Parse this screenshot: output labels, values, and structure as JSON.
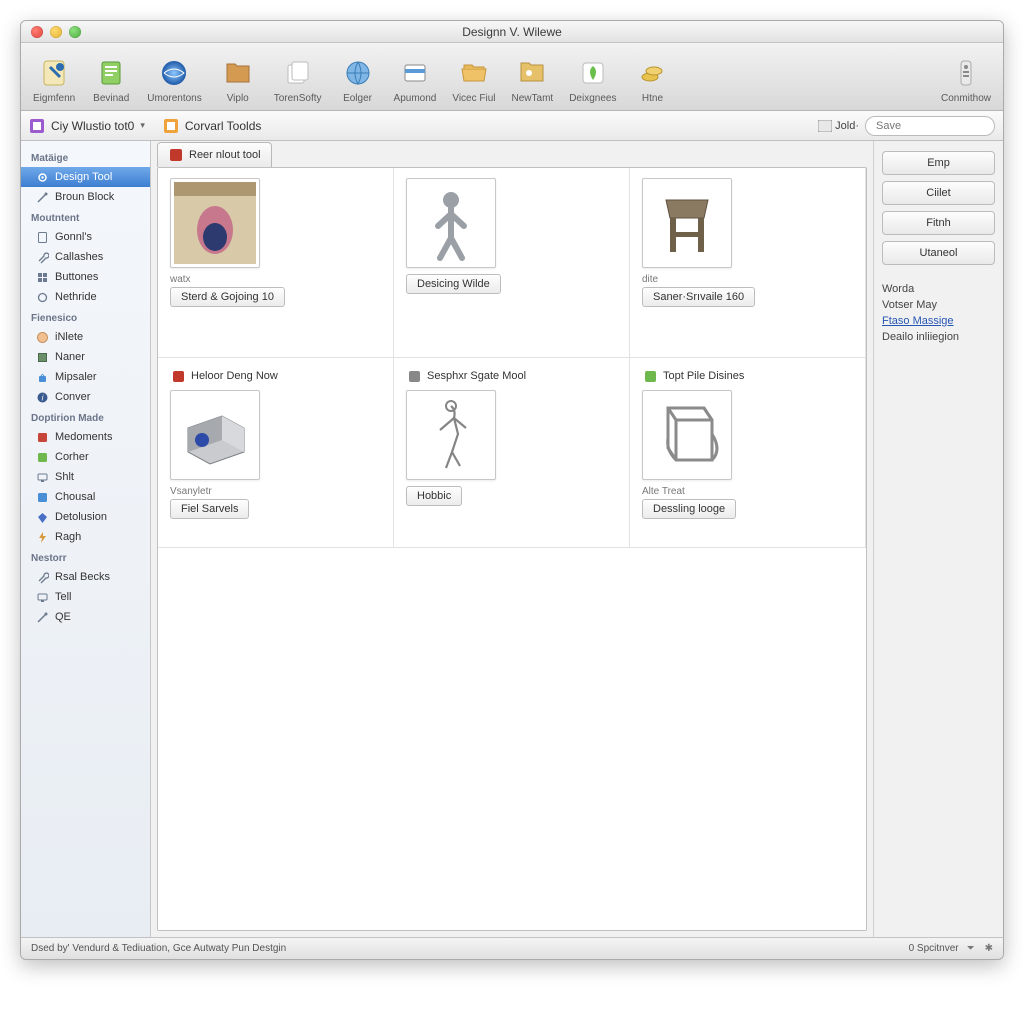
{
  "window_title": "Designn V. Wilewe",
  "toolbar": [
    {
      "id": "eigmfenn",
      "label": "Eigmfenn",
      "icon": "pin"
    },
    {
      "id": "bevinad",
      "label": "Bevinad",
      "icon": "doc-green"
    },
    {
      "id": "umorentons",
      "label": "Umorentons",
      "icon": "globe-blue"
    },
    {
      "id": "viplo",
      "label": "Viplo",
      "icon": "folder-brown"
    },
    {
      "id": "torensofty",
      "label": "TorenSofty",
      "icon": "pages"
    },
    {
      "id": "eolger",
      "label": "Eolger",
      "icon": "globe-plain"
    },
    {
      "id": "apumond",
      "label": "Apumond",
      "icon": "card"
    },
    {
      "id": "vicecfiul",
      "label": "Vicec Fiul",
      "icon": "folder-open"
    },
    {
      "id": "newtamt",
      "label": "NewTamt",
      "icon": "folder-img"
    },
    {
      "id": "deixgnees",
      "label": "Deixgnees",
      "icon": "leaf"
    },
    {
      "id": "htne",
      "label": "Htne",
      "icon": "coins"
    }
  ],
  "toolbar_right": {
    "id": "conmithow",
    "label": "Conmithow",
    "icon": "remote"
  },
  "subbar": {
    "left1": "Ciy Wlustio tot0",
    "left2": "Corvarl Toolds",
    "jod_label": "Jold·",
    "search_placeholder": "Save"
  },
  "sidebar": {
    "groups": [
      {
        "head": "Matäige",
        "items": [
          {
            "id": "design-tool",
            "label": "Design Tool",
            "icon": "gear",
            "selected": true
          },
          {
            "id": "broun-block",
            "label": "Broun Block",
            "icon": "wand"
          }
        ]
      },
      {
        "head": "Moutntent",
        "items": [
          {
            "id": "gonnls",
            "label": "Gonnl's",
            "icon": "doc"
          },
          {
            "id": "callashes",
            "label": "Callashes",
            "icon": "wrench"
          },
          {
            "id": "buttones",
            "label": "Buttones",
            "icon": "grid"
          },
          {
            "id": "nethride",
            "label": "Nethride",
            "icon": "cog"
          }
        ]
      },
      {
        "head": "Fienesico",
        "items": [
          {
            "id": "inlete",
            "label": "iNlete",
            "icon": "face"
          },
          {
            "id": "naner",
            "label": "Naner",
            "icon": "chip"
          },
          {
            "id": "mipsaler",
            "label": "Mipsaler",
            "icon": "bag"
          },
          {
            "id": "conver",
            "label": "Conver",
            "icon": "info"
          }
        ]
      },
      {
        "head": "Doptirion Made",
        "items": [
          {
            "id": "medoments",
            "label": "Medoments",
            "icon": "red-sq"
          },
          {
            "id": "corher",
            "label": "Corher",
            "icon": "green-sq"
          },
          {
            "id": "shlt",
            "label": "Shlt",
            "icon": "screen"
          },
          {
            "id": "chousal",
            "label": "Chousal",
            "icon": "blue-sq"
          },
          {
            "id": "detolusion",
            "label": "Detolusion",
            "icon": "gem"
          },
          {
            "id": "ragh",
            "label": "Ragh",
            "icon": "bolt"
          }
        ]
      },
      {
        "head": "Nestorr",
        "items": [
          {
            "id": "rsal-becks",
            "label": "Rsal Becks",
            "icon": "wrench"
          },
          {
            "id": "tell",
            "label": "Tell",
            "icon": "screen"
          },
          {
            "id": "qe",
            "label": "QE",
            "icon": "wand"
          }
        ]
      }
    ]
  },
  "tab_label": "Reer nlout tool",
  "cells": [
    {
      "head": "",
      "sub": "watx",
      "btn": "Sterd & Gojoing 10",
      "thumb": "anatomy"
    },
    {
      "head": "",
      "sub": "",
      "btn": "Desicing Wilde",
      "thumb": "person"
    },
    {
      "head": "",
      "sub": "dite",
      "btn": "Saner·Srıvaile 160",
      "thumb": "stool"
    },
    {
      "head": "Heloor Deng Now",
      "sub": "Vsanyletr",
      "btn": "Fiel Sarvels",
      "thumb": "block"
    },
    {
      "head": "Sesphxr Sgate Mool",
      "sub": "",
      "btn": "Hobbic",
      "thumb": "figure"
    },
    {
      "head": "Topt Pile Disines",
      "sub": "Alte Treat",
      "btn": "Dessling looge",
      "thumb": "frame"
    }
  ],
  "right_buttons": [
    "Emp",
    "Ciilet",
    "Fitnh",
    "Utaneol"
  ],
  "right_info": {
    "l1": "Worda",
    "l2": "Votser May",
    "l3": "Ftaso Massige",
    "l4": "Deailo inliiegion"
  },
  "status": {
    "left": "Dsed by' Vendurd & Tediuation, Gce Autwaty Pun Destgin",
    "right": "0 Spcitnver"
  }
}
